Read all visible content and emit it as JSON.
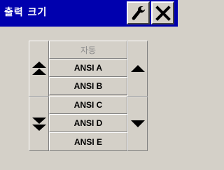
{
  "window": {
    "title": "출력 크기",
    "wrench_icon": "wrench-icon",
    "close_icon": "close-icon"
  },
  "size_list": {
    "items": [
      {
        "label": "자동",
        "enabled": false
      },
      {
        "label": "ANSI A",
        "enabled": true
      },
      {
        "label": "ANSI B",
        "enabled": true
      },
      {
        "label": "ANSI C",
        "enabled": true
      },
      {
        "label": "ANSI D",
        "enabled": true
      },
      {
        "label": "ANSI E",
        "enabled": true
      }
    ]
  },
  "scroll_buttons": {
    "page_up_icon": "double-up-arrow-icon",
    "page_down_icon": "double-down-arrow-icon",
    "up_icon": "up-arrow-icon",
    "down_icon": "down-arrow-icon"
  },
  "colors": {
    "titlebar": "#0000ae",
    "background": "#d4d0c8",
    "disabled_text": "#8c8c8c"
  }
}
